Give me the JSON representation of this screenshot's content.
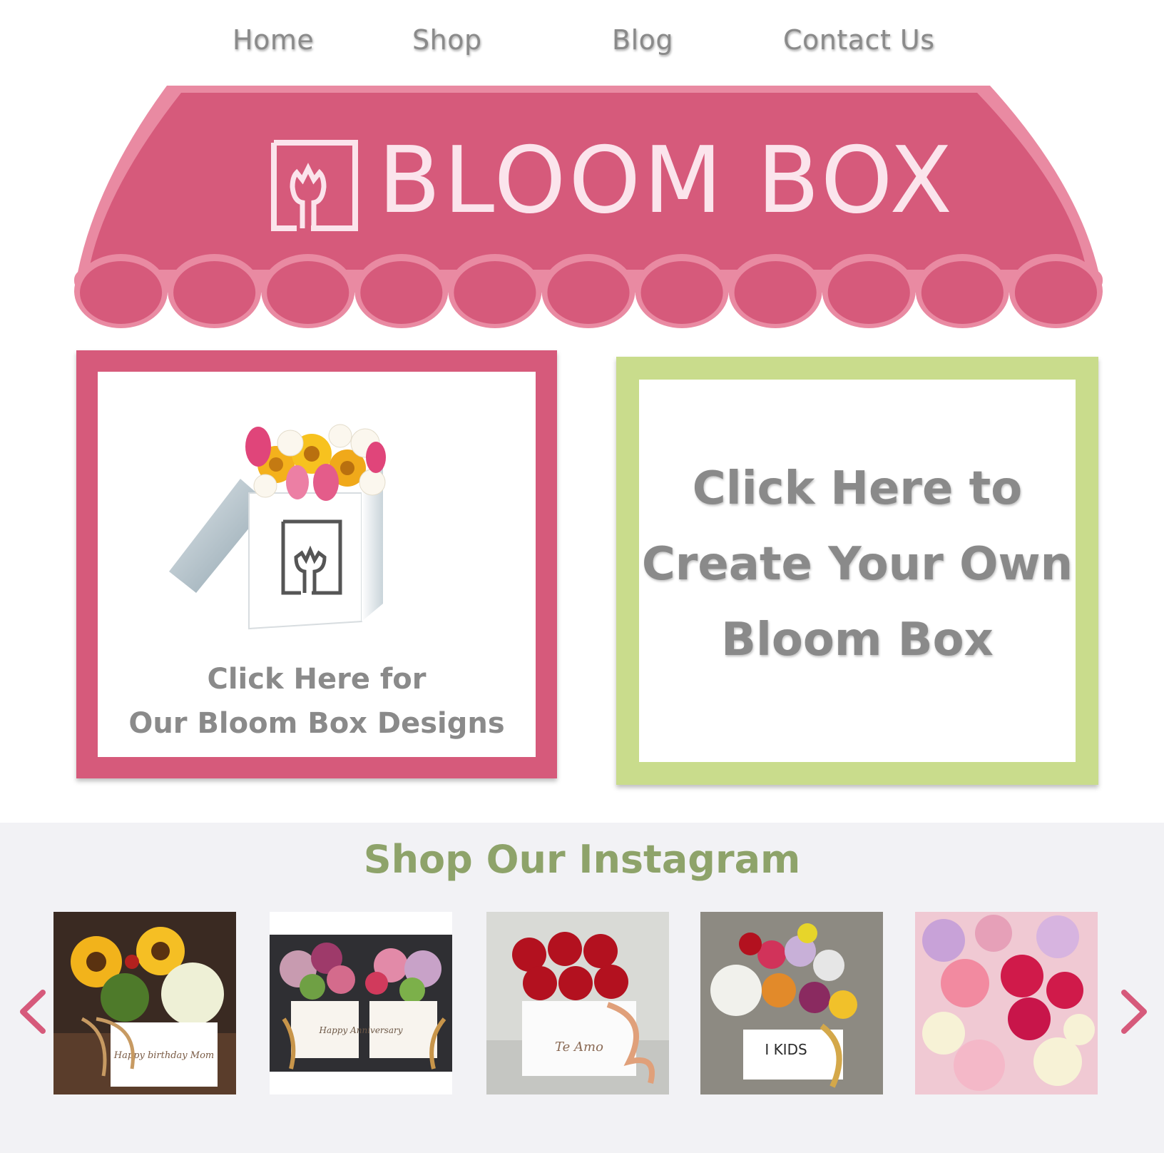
{
  "nav": {
    "items": [
      "Home",
      "Shop",
      "Blog",
      "Contact Us"
    ]
  },
  "brand": {
    "name": "BLOOM BOX",
    "awning_color": "#d65a7b",
    "awning_light": "#e98aa2",
    "logo_color": "#fbe4ec"
  },
  "cards": {
    "designs": {
      "line1": "Click Here for",
      "line2": "Our Bloom Box Designs",
      "border_color": "#d65a7b"
    },
    "create": {
      "line1": "Click Here to",
      "line2": "Create Your Own",
      "line3": "Bloom Box",
      "border_color": "#c9dc8c"
    }
  },
  "instagram": {
    "title": "Shop Our Instagram",
    "title_color": "#8ea36a",
    "arrow_color": "#d65a7b",
    "prev_icon": "chevron-left-icon",
    "next_icon": "chevron-right-icon",
    "posts": [
      {
        "caption": "Happy birthday Mom"
      },
      {
        "caption": "Happy Anniversary"
      },
      {
        "caption": "Te Amo"
      },
      {
        "caption": "I KIDS"
      },
      {
        "caption": ""
      }
    ]
  }
}
